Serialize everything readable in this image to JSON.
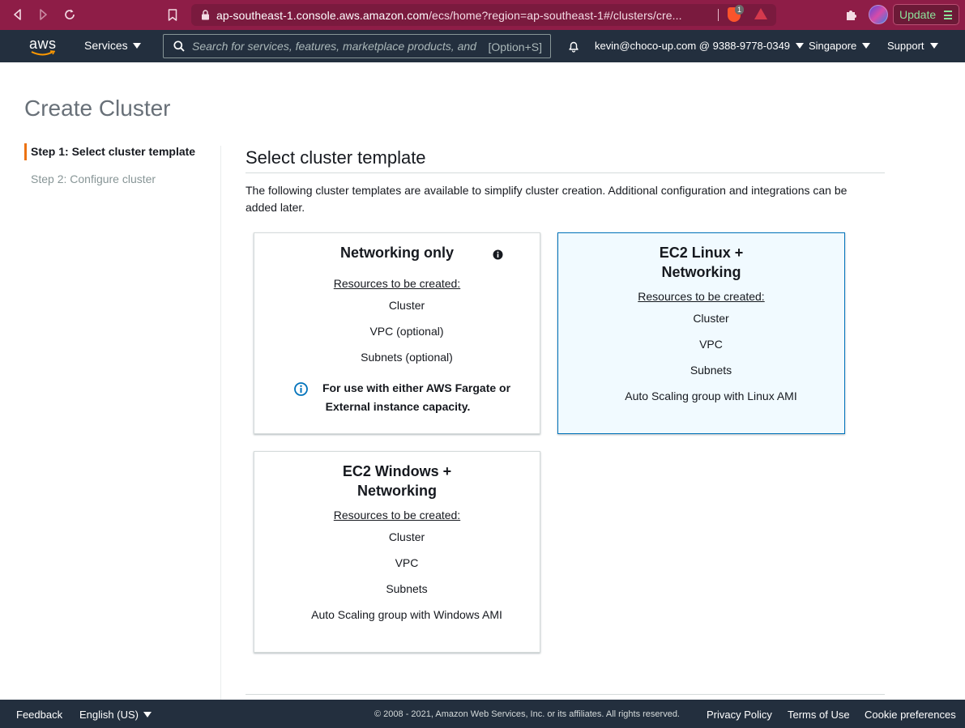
{
  "browser": {
    "url_host": "ap-southeast-1.console.aws.amazon.com",
    "url_path": "/ecs/home?region=ap-southeast-1#/clusters/cre...",
    "shield_count": "1",
    "update_label": "Update"
  },
  "aws_nav": {
    "logo": "aws",
    "services_label": "Services",
    "search_placeholder": "Search for services, features, marketplace products, and",
    "search_shortcut": "[Option+S]",
    "account": "kevin@choco-up.com @ 9388-9778-0349",
    "region": "Singapore",
    "support": "Support"
  },
  "page": {
    "title": "Create Cluster",
    "steps": [
      {
        "label": "Step 1: Select cluster template",
        "active": true
      },
      {
        "label": "Step 2: Configure cluster",
        "active": false
      }
    ],
    "section_title": "Select cluster template",
    "section_description": "The following cluster templates are available to simplify cluster creation. Additional configuration and integrations can be added later."
  },
  "cards": {
    "networking_only": {
      "title": "Networking only",
      "resources_label": "Resources to be created:",
      "items": [
        "Cluster",
        "VPC (optional)",
        "Subnets (optional)"
      ],
      "note_line1": "For use with either AWS Fargate or",
      "note_line2": "External instance capacity."
    },
    "ec2_linux": {
      "title_line1": "EC2 Linux +",
      "title_line2": "Networking",
      "resources_label": "Resources to be created:",
      "items": [
        "Cluster",
        "VPC",
        "Subnets",
        "Auto Scaling group with Linux AMI"
      ],
      "selected": true
    },
    "ec2_windows": {
      "title_line1": "EC2 Windows +",
      "title_line2": "Networking",
      "resources_label": "Resources to be created:",
      "items": [
        "Cluster",
        "VPC",
        "Subnets",
        "Auto Scaling group with Windows AMI"
      ]
    }
  },
  "footer": {
    "feedback": "Feedback",
    "language": "English (US)",
    "copyright": "© 2008 - 2021, Amazon Web Services, Inc. or its affiliates. All rights reserved.",
    "privacy": "Privacy Policy",
    "terms": "Terms of Use",
    "cookies": "Cookie preferences"
  },
  "colors": {
    "browser_bar": "#8e1d47",
    "aws_nav": "#232f3e",
    "accent_orange": "#ec7211",
    "selected_card_bg": "#f1faff",
    "selected_card_border": "#0073bb",
    "info_blue": "#0073bb"
  }
}
